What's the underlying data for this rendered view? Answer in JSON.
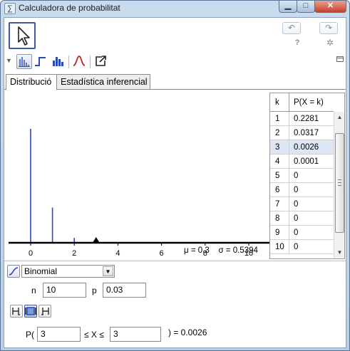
{
  "window": {
    "title": "Calculadora de probabilitat",
    "minimize_glyph": "▁",
    "maximize_glyph": "□",
    "close_glyph": "✕"
  },
  "toolbar": {
    "undo_glyph": "↶",
    "redo_glyph": "↷",
    "help_glyph": "?",
    "settings_glyph": "✲"
  },
  "tabs": [
    {
      "label": "Distribució",
      "active": true
    },
    {
      "label": "Estadística inferencial",
      "active": false
    }
  ],
  "chart_data": {
    "type": "bar",
    "x": [
      0,
      1,
      2,
      3,
      4,
      5,
      6,
      7,
      8,
      9,
      10
    ],
    "values": [
      0.7374,
      0.2281,
      0.0317,
      0.0026,
      0.0001,
      0,
      0,
      0,
      0,
      0,
      0
    ],
    "xticks": [
      "0",
      "2",
      "4",
      "6",
      "8",
      "10"
    ],
    "xlim": [
      -1,
      10.9
    ],
    "marker_x": 3,
    "color": "#2a49b5"
  },
  "stats": {
    "mean_label": "μ = 0.3",
    "sigma_label": "σ = 0.5394"
  },
  "table": {
    "col_k": "k",
    "col_p": "P(X = k)",
    "selected_k": "3",
    "rows": [
      {
        "k": "1",
        "p": "0.2281"
      },
      {
        "k": "2",
        "p": "0.0317"
      },
      {
        "k": "3",
        "p": "0.0026"
      },
      {
        "k": "4",
        "p": "0.0001"
      },
      {
        "k": "5",
        "p": "0"
      },
      {
        "k": "6",
        "p": "0"
      },
      {
        "k": "7",
        "p": "0"
      },
      {
        "k": "8",
        "p": "0"
      },
      {
        "k": "9",
        "p": "0"
      },
      {
        "k": "10",
        "p": "0"
      }
    ]
  },
  "distribution": {
    "selected": "Binomial",
    "n_label": "n",
    "n_value": "10",
    "p_label": "p",
    "p_value": "0.03"
  },
  "probability": {
    "prefix": "P(",
    "low": "3",
    "op": "≤ X ≤",
    "high": "3",
    "result": ") =  0.0026"
  }
}
